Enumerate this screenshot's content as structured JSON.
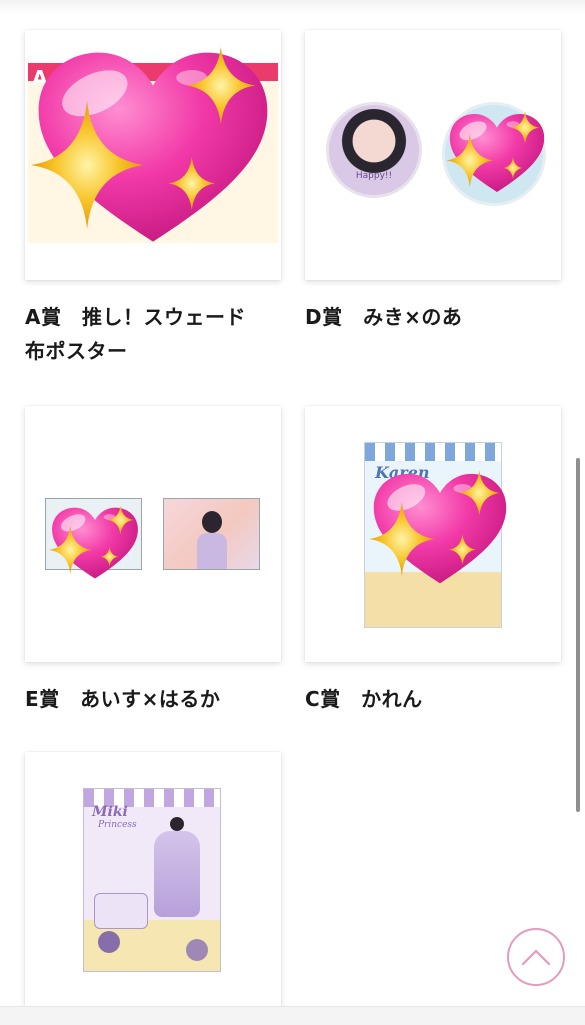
{
  "products": [
    {
      "label": "A賞　推し！スウェード\n布ポスター",
      "banner_text": "A"
    },
    {
      "label": "D賞　みき×のあ",
      "badge_text": "Happy!!"
    },
    {
      "label": "E賞　あいす×はるか"
    },
    {
      "label": "C賞　かれん",
      "stand_title": "Karen"
    },
    {
      "label": "",
      "stand_title": "Miki",
      "stand_subtitle": "Princess"
    }
  ],
  "colors": {
    "heart": "#f23aa8",
    "sparkle": "#f5b81c",
    "scroll_top_ring": "#e59ac1"
  },
  "icons": {
    "overlay": "sparkling-heart-icon",
    "scroll_top": "chevron-up-icon"
  }
}
